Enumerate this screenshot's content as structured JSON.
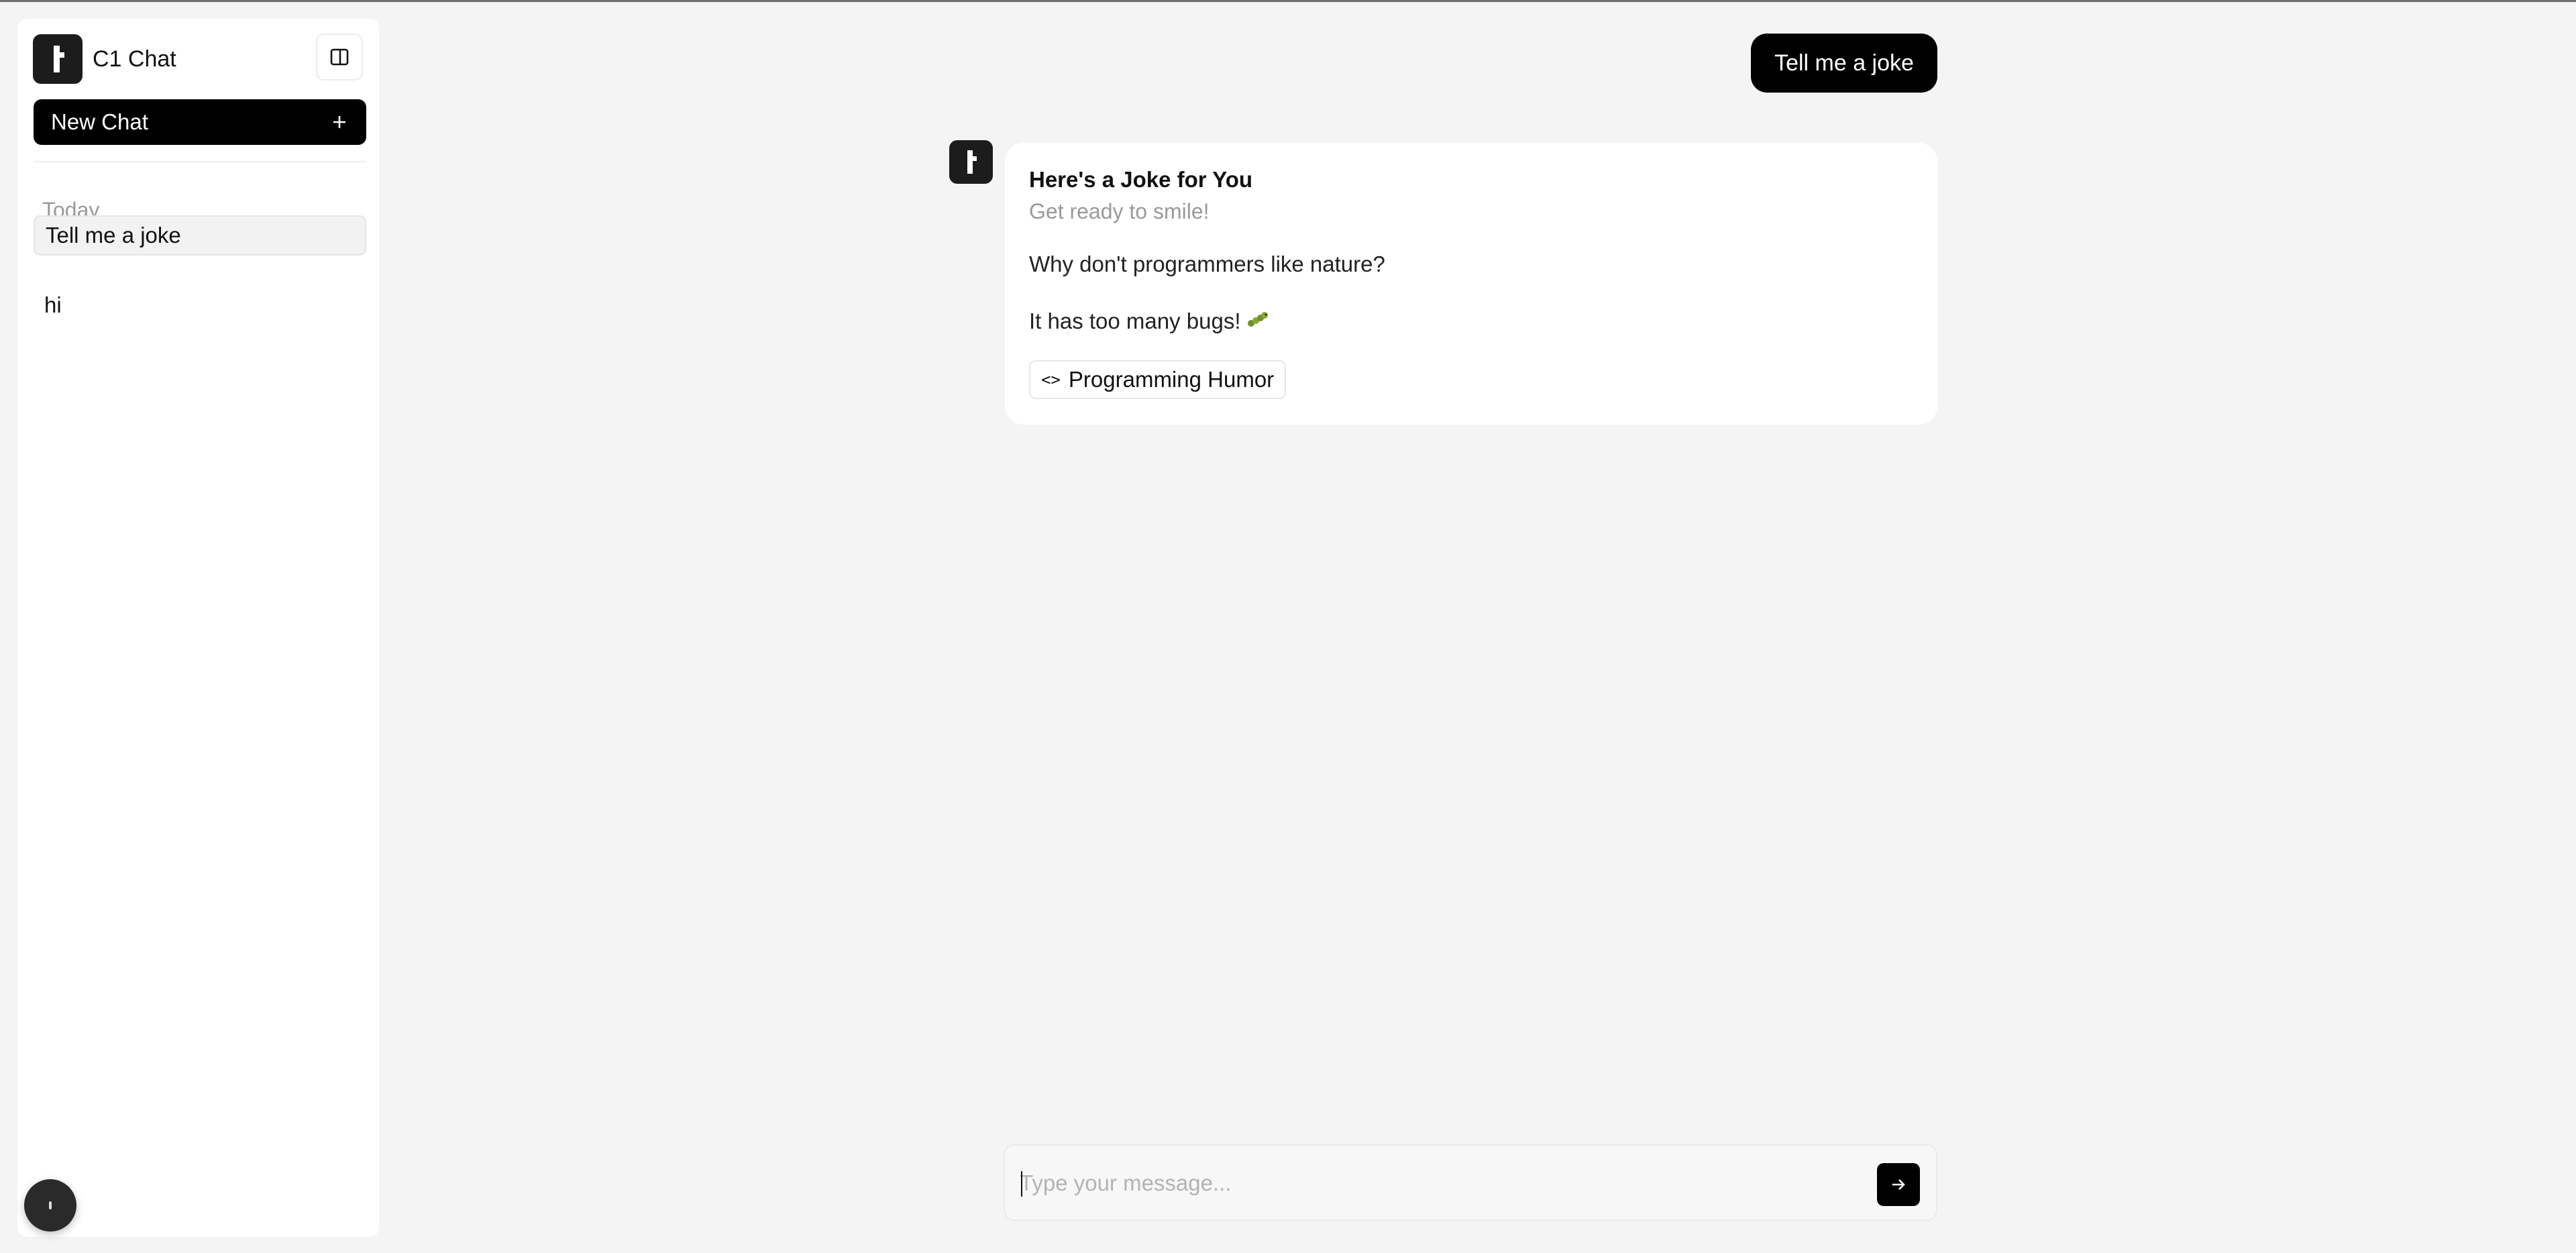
{
  "app": {
    "title": "C1 Chat"
  },
  "sidebar": {
    "new_chat_label": "New Chat",
    "section_today": "Today",
    "items": [
      {
        "label": "Tell me a joke",
        "active": true
      },
      {
        "label": "hi",
        "active": false
      }
    ]
  },
  "conversation": {
    "user_message": "Tell me a joke",
    "reply": {
      "title": "Here's a Joke for You",
      "subtitle": "Get ready to smile!",
      "line1": "Why don't programmers like nature?",
      "line2": "It has too many bugs!",
      "tag": "Programming Humor"
    }
  },
  "composer": {
    "placeholder": "Type your message...",
    "value": ""
  },
  "icons": {
    "logo": "brand-logo-icon",
    "collapse": "sidebar-toggle-icon",
    "new_chat": "plus-icon",
    "tag": "code-icon",
    "bug": "caterpillar-icon",
    "send": "arrow-right-icon"
  },
  "colors": {
    "accent": "#000000",
    "background": "#f4f4f4",
    "muted": "#9a9a9a"
  }
}
